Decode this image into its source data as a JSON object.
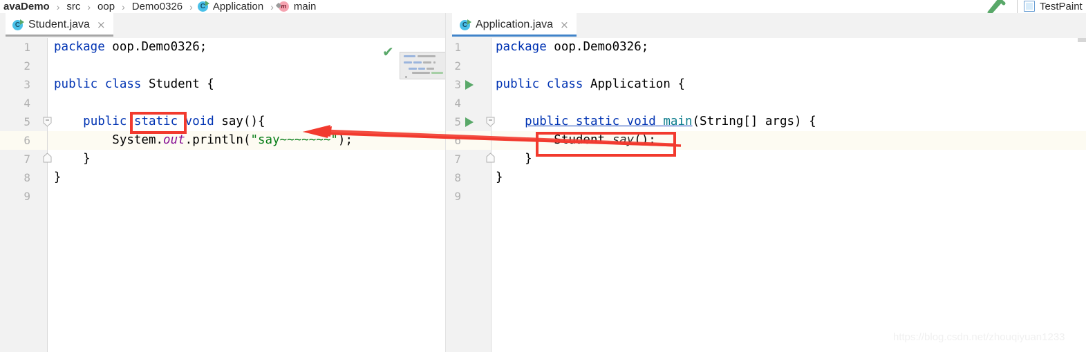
{
  "breadcrumb": {
    "items": [
      {
        "label": "avaDemo",
        "icon": null
      },
      {
        "label": "src",
        "icon": null
      },
      {
        "label": "oop",
        "icon": null
      },
      {
        "label": "Demo0326",
        "icon": null
      },
      {
        "label": "Application",
        "icon": "class-icon"
      },
      {
        "label": "main",
        "icon": "method-icon"
      }
    ],
    "separator": "›"
  },
  "toolbar": {
    "build_icon": "hammer-icon",
    "extra_tab_label": "TestPaint",
    "extra_tab_icon": "file-icon"
  },
  "panes": {
    "left": {
      "tab": {
        "label": "Student.java",
        "icon": "java-class-icon",
        "close": "×",
        "state": "inactive-split"
      },
      "status_icon": "green-check-icon",
      "lines": [
        {
          "num": "1",
          "text": "package oop.Demo0326;"
        },
        {
          "num": "2",
          "text": ""
        },
        {
          "num": "3",
          "text": "public class Student {"
        },
        {
          "num": "4",
          "text": ""
        },
        {
          "num": "5",
          "text": "    public static void say(){"
        },
        {
          "num": "6",
          "text": "        System.out.println(\"say~~~~~~~\");"
        },
        {
          "num": "7",
          "text": "    }"
        },
        {
          "num": "8",
          "text": "}"
        },
        {
          "num": "9",
          "text": ""
        }
      ],
      "caret_line": "6"
    },
    "right": {
      "tab": {
        "label": "Application.java",
        "icon": "java-runnable-class-icon",
        "close": "×",
        "state": "active"
      },
      "lines": [
        {
          "num": "1",
          "text": "package oop.Demo0326;"
        },
        {
          "num": "2",
          "text": ""
        },
        {
          "num": "3",
          "text": "public class Application {"
        },
        {
          "num": "4",
          "text": ""
        },
        {
          "num": "5",
          "text": "    public static void main(String[] args) {"
        },
        {
          "num": "6",
          "text": "        Student.say();"
        },
        {
          "num": "7",
          "text": "    }"
        },
        {
          "num": "8",
          "text": "}"
        },
        {
          "num": "9",
          "text": ""
        }
      ],
      "caret_line": "6",
      "run_gutter_lines": [
        "3",
        "5"
      ]
    }
  },
  "annotations": {
    "rect_static_label": "static",
    "rect_call_label": "Student.say();",
    "arrow_color": "#f23a2e",
    "rect_color": "#f23a2e"
  },
  "watermark": {
    "text": "https://blog.csdn.net/zhouqiyuan1233"
  },
  "colors": {
    "keyword": "#0033b3",
    "string": "#067d17",
    "static_field": "#871094",
    "method_name": "#0b7c8c",
    "caret_line_bg": "#fdfbf2",
    "gutter_bg": "#f2f2f2",
    "tab_active_underline": "#4083c9",
    "tab_inactive_underline": "#a6a6a6",
    "run_green": "#59a869"
  }
}
